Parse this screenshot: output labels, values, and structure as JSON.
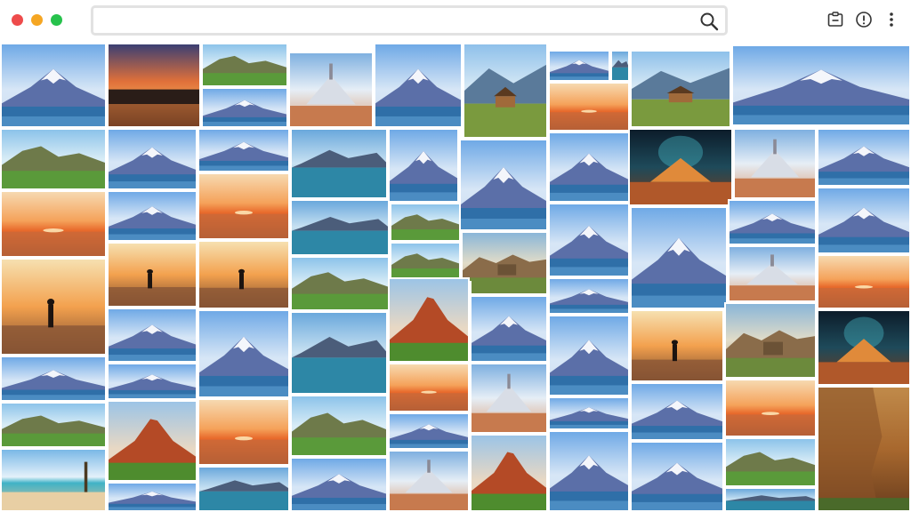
{
  "window": {
    "traffic_lights": [
      {
        "name": "close",
        "color": "#ee4b4b"
      },
      {
        "name": "minimize",
        "color": "#f5a623"
      },
      {
        "name": "maximize",
        "color": "#27c24c"
      }
    ]
  },
  "search": {
    "value": "",
    "placeholder": "",
    "icon": "search-icon"
  },
  "toolbar": {
    "icons": [
      "clipboard-icon",
      "info-icon",
      "more-vertical-icon"
    ]
  },
  "gallery": {
    "tile_count": 62,
    "themes": [
      "snow-mountain",
      "sunset-sea",
      "green-hills",
      "silhouette",
      "desert-ruin",
      "red-volcano",
      "temple-glow",
      "beach",
      "hut",
      "cliff"
    ]
  }
}
